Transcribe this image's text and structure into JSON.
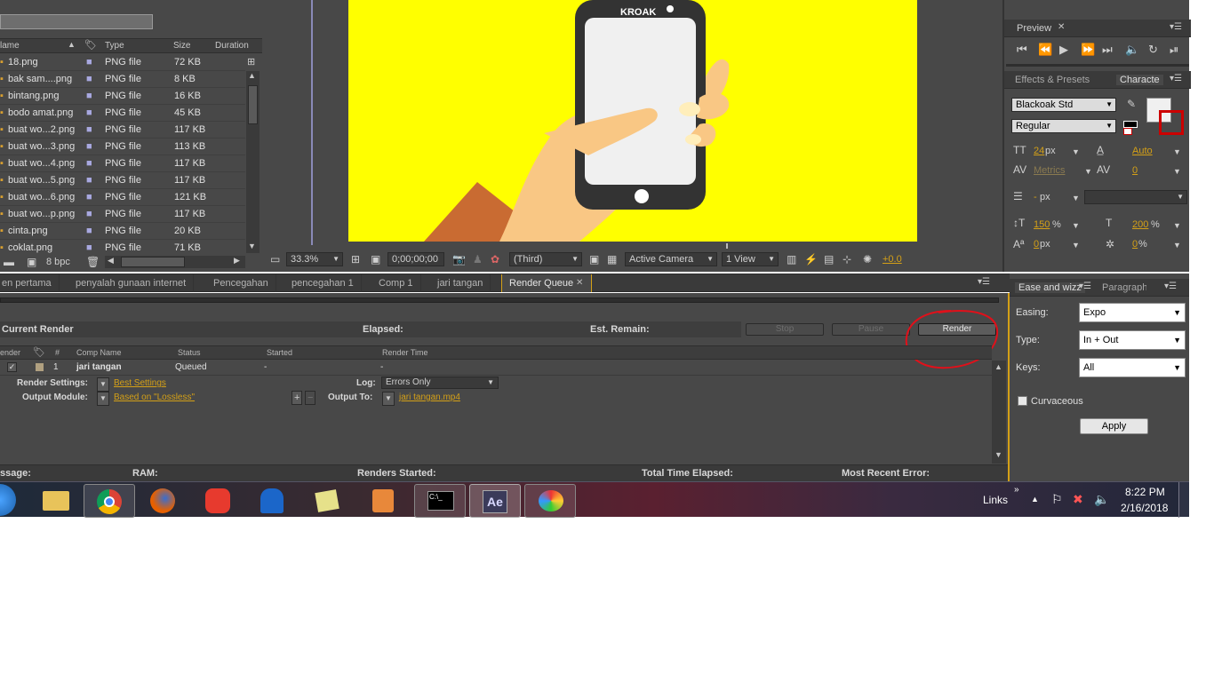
{
  "project": {
    "columns": [
      "lame",
      "Type",
      "Size",
      "Duration"
    ],
    "files": [
      {
        "name": "18.png",
        "type": "PNG file",
        "size": "72 KB"
      },
      {
        "name": "bak sam....png",
        "type": "PNG file",
        "size": "8 KB"
      },
      {
        "name": "bintang.png",
        "type": "PNG file",
        "size": "16 KB"
      },
      {
        "name": "bodo amat.png",
        "type": "PNG file",
        "size": "45 KB"
      },
      {
        "name": "buat wo...2.png",
        "type": "PNG file",
        "size": "117 KB"
      },
      {
        "name": "buat wo...3.png",
        "type": "PNG file",
        "size": "113 KB"
      },
      {
        "name": "buat wo...4.png",
        "type": "PNG file",
        "size": "117 KB"
      },
      {
        "name": "buat wo...5.png",
        "type": "PNG file",
        "size": "117 KB"
      },
      {
        "name": "buat wo...6.png",
        "type": "PNG file",
        "size": "121 KB"
      },
      {
        "name": "buat wo...p.png",
        "type": "PNG file",
        "size": "117 KB"
      },
      {
        "name": "cinta.png",
        "type": "PNG file",
        "size": "20 KB"
      },
      {
        "name": "coklat.png",
        "type": "PNG file",
        "size": "71 KB"
      }
    ],
    "bpc": "8 bpc"
  },
  "composition": {
    "phone_brand": "KROAK",
    "background_color": "#ffff00"
  },
  "viewer": {
    "zoom": "33.3%",
    "timecode": "0;00;00;00",
    "resolution": "(Third)",
    "camera": "Active Camera",
    "view": "1 View",
    "exposure": "+0.0"
  },
  "preview": {
    "title": "Preview"
  },
  "effects_tab": "Effects & Presets",
  "character": {
    "tab": "Characte",
    "font": "Blackoak Std",
    "style": "Regular",
    "size": "24",
    "size_unit": "px",
    "leading": "Auto",
    "kerning": "Metrics",
    "tracking": "0",
    "stroke_unit": "px",
    "stroke_prefix": "-",
    "vscale": "150",
    "hscale": "200",
    "baseline": "0",
    "baseline_unit": "px",
    "tsume": "0",
    "percent": "%"
  },
  "timeline_tabs": [
    "en pertama",
    "penyalah gunaan internet",
    "Pencegahan",
    "pencegahan 1",
    "Comp 1",
    "jari tangan",
    "Render Queue"
  ],
  "render_queue": {
    "current_render": "Current Render",
    "elapsed": "Elapsed:",
    "est_remain": "Est. Remain:",
    "stop": "Stop",
    "pause": "Pause",
    "render": "Render",
    "columns": [
      "ender",
      "#",
      "Comp Name",
      "Status",
      "Started",
      "Render Time"
    ],
    "item": {
      "number": "1",
      "comp": "jari tangan",
      "status": "Queued",
      "started": "-",
      "render_time": "-"
    },
    "render_settings_label": "Render Settings:",
    "render_settings_value": "Best Settings",
    "log_label": "Log:",
    "log_value": "Errors Only",
    "output_module_label": "Output Module:",
    "output_module_value": "Based on \"Lossless\"",
    "output_to_label": "Output To:",
    "output_to_value": "jari tangan.mp4",
    "footer": {
      "message": "ssage:",
      "ram": "RAM:",
      "renders_started": "Renders Started:",
      "total_time": "Total Time Elapsed:",
      "recent_error": "Most Recent Error:"
    }
  },
  "ease_panel": {
    "tab": "Ease and wizz",
    "tab2": "Paragraph",
    "easing_label": "Easing:",
    "easing_value": "Expo",
    "type_label": "Type:",
    "type_value": "In + Out",
    "keys_label": "Keys:",
    "keys_value": "All",
    "curvaceous": "Curvaceous",
    "apply": "Apply"
  },
  "taskbar": {
    "links": "Links",
    "time": "8:22 PM",
    "date": "2/16/2018",
    "cmd_text": "C:\\_"
  }
}
